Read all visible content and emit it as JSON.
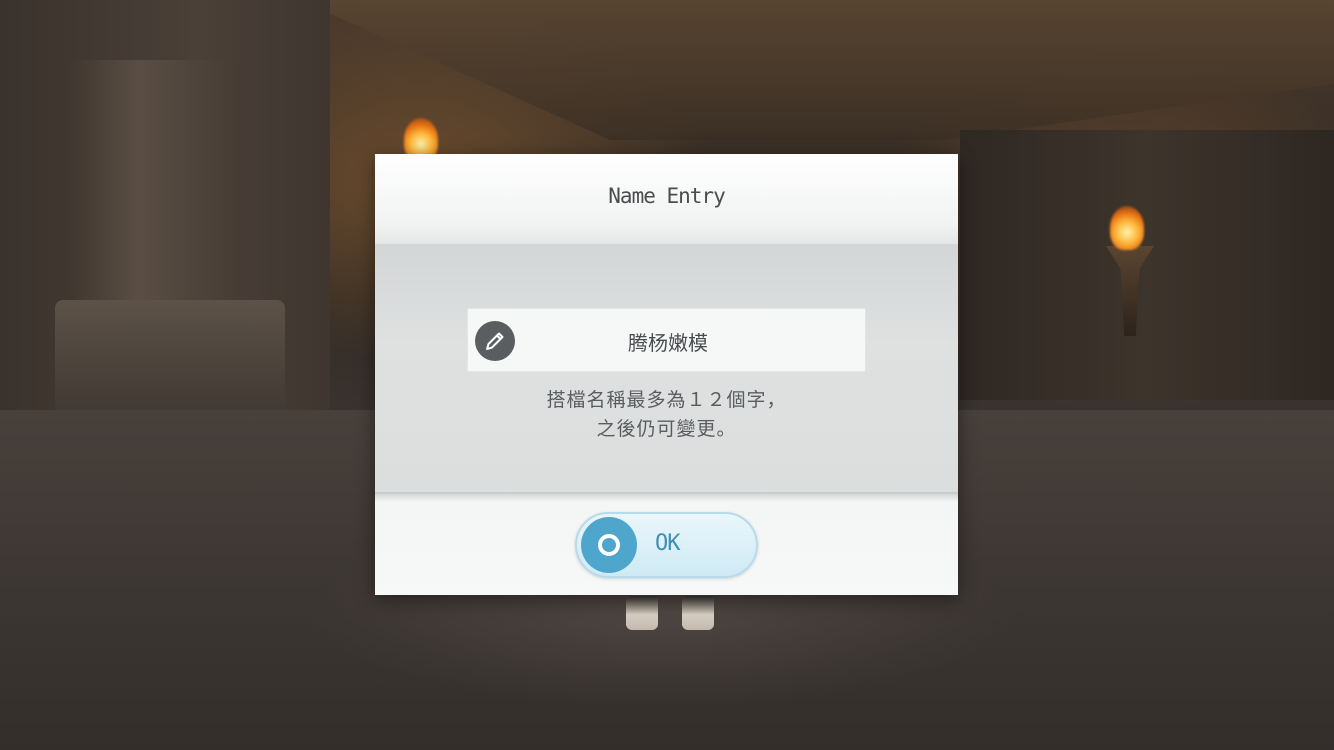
{
  "dialog": {
    "title": "Name Entry",
    "name_value": "腾杨嫩模",
    "hint_line1": "搭檔名稱最多為１２個字，",
    "hint_line2": "之後仍可變更。",
    "ok_label": "OK"
  },
  "icons": {
    "edit": "pencil-icon",
    "confirm": "circle-button-icon"
  },
  "colors": {
    "accent": "#4ea6cc",
    "title_text": "#4a4d50"
  }
}
